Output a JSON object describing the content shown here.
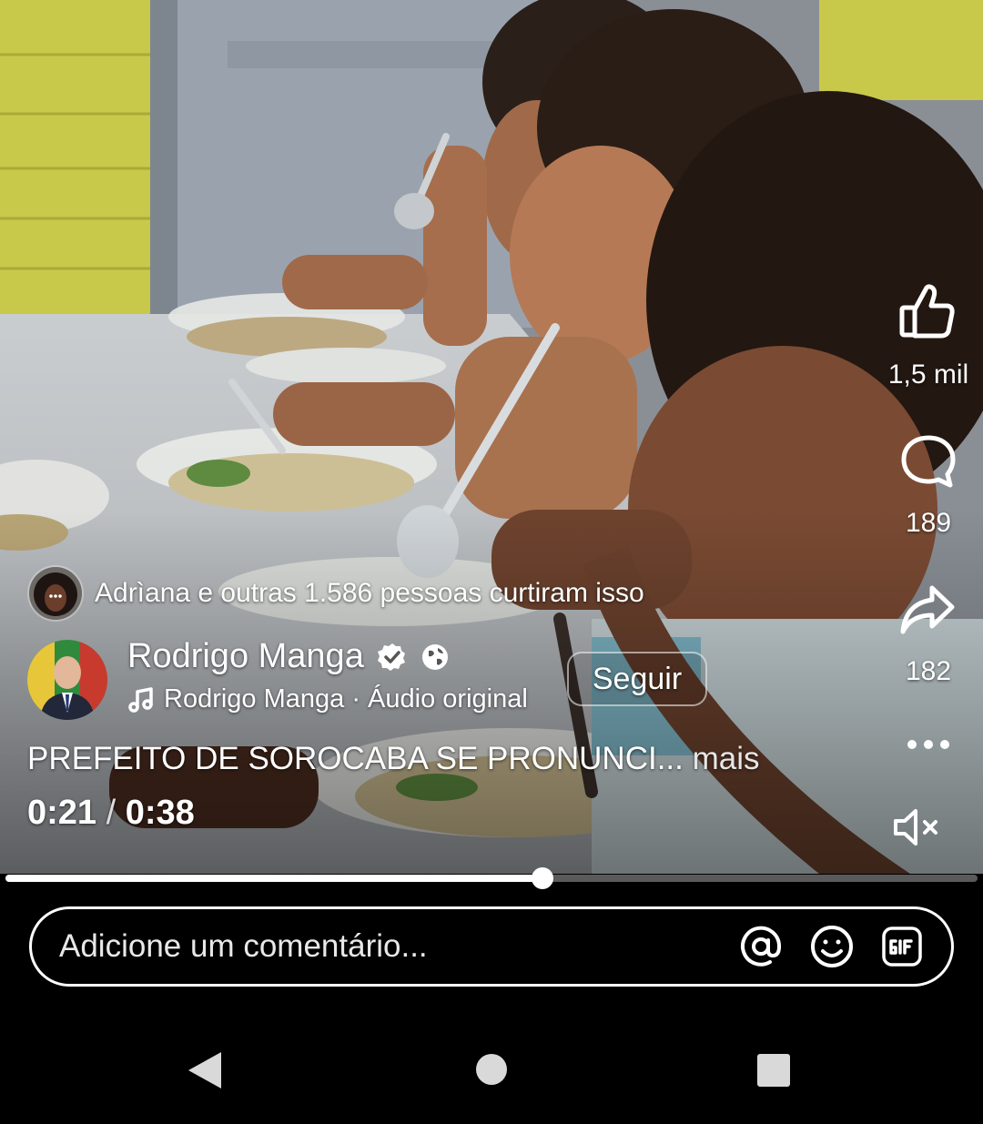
{
  "actions": {
    "like_count": "1,5 mil",
    "comment_count": "189",
    "share_count": "182"
  },
  "liked_by": {
    "text": "Adrìana e outras 1.586 pessoas curtiram isso"
  },
  "author": {
    "name": "Rodrigo Manga",
    "audio": "Rodrigo Manga · Áudio original",
    "follow_label": "Seguir"
  },
  "caption": {
    "text": "PREFEITO DE SOROCABA SE PRONUNCI...",
    "more_label": "mais"
  },
  "playback": {
    "current": "0:21",
    "separator": "/",
    "duration": "0:38",
    "progress_fraction": 0.5526
  },
  "comment": {
    "placeholder": "Adicione um comentário..."
  },
  "icons": {
    "like": "thumbs-up-icon",
    "comment": "comment-bubble-icon",
    "share": "share-arrow-icon",
    "more": "more-dots-icon",
    "mute": "volume-muted-icon",
    "verified": "verified-badge-icon",
    "globe": "globe-icon",
    "music": "music-note-icon",
    "mention": "at-sign-icon",
    "emoji": "emoji-icon",
    "gif": "gif-icon",
    "nav_back": "nav-back-icon",
    "nav_home": "nav-home-icon",
    "nav_recents": "nav-recents-icon"
  },
  "colors": {
    "background": "#000000",
    "text": "#ffffff",
    "progress_track": "#5a5a5a",
    "verified_badge": "#ffffff"
  }
}
